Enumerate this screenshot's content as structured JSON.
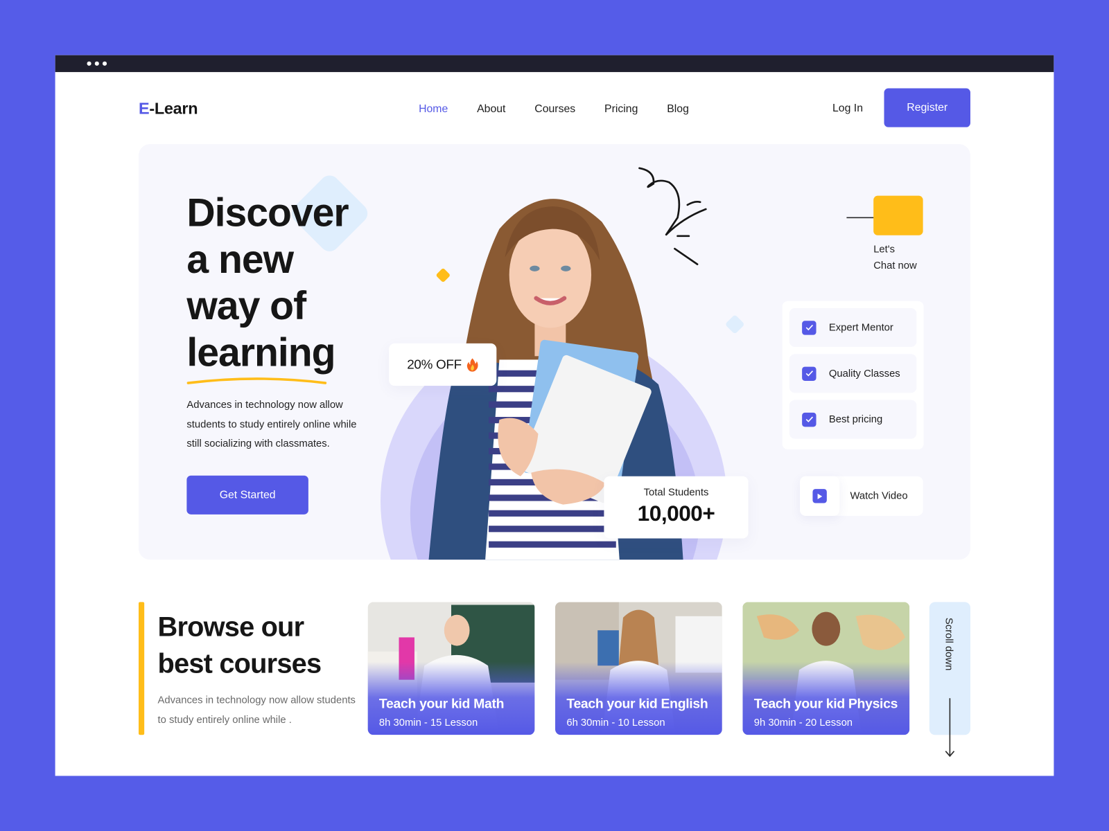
{
  "window": {
    "controls": [
      "dot",
      "dot",
      "dot"
    ]
  },
  "brand": {
    "accent_letter": "E",
    "rest": "-Learn",
    "accent_color": "#5559e6"
  },
  "nav": {
    "items": [
      {
        "label": "Home",
        "active": true
      },
      {
        "label": "About",
        "active": false
      },
      {
        "label": "Courses",
        "active": false
      },
      {
        "label": "Pricing",
        "active": false
      },
      {
        "label": "Blog",
        "active": false
      }
    ],
    "login_label": "Log In",
    "register_label": "Register"
  },
  "hero": {
    "headline_lines": [
      "Discover",
      "a new",
      "way of",
      "learning"
    ],
    "description": "Advances in technology now allow students to study entirely online while still socializing with classmates.",
    "cta_label": "Get Started",
    "discount_badge": "20% OFF",
    "discount_icon": "fire-icon",
    "stats": {
      "label": "Total Students",
      "value": "10,000+"
    },
    "chat": {
      "line1": "Let's",
      "line2": "Chat now"
    },
    "features": [
      {
        "label": "Expert Mentor",
        "checked": true
      },
      {
        "label": "Quality Classes",
        "checked": true
      },
      {
        "label": "Best pricing",
        "checked": true
      }
    ],
    "watch_video_label": "Watch Video"
  },
  "courses_section": {
    "title_lines": [
      "Browse our",
      "best courses"
    ],
    "description": "Advances in technology now allow students to study entirely online while .",
    "courses": [
      {
        "title": "Teach your kid Math",
        "meta": "8h 30min - 15 Lesson"
      },
      {
        "title": "Teach your kid English",
        "meta": "6h 30min - 10 Lesson"
      },
      {
        "title": "Teach your kid Physics",
        "meta": "9h 30min - 20 Lesson"
      }
    ],
    "scroll_label": "Scroll down"
  },
  "colors": {
    "primary": "#5559e6",
    "yellow": "#ffbd19",
    "light_blue": "#dfeefd",
    "hero_bg": "#f7f7fd",
    "frame": "#1f1f2e"
  }
}
